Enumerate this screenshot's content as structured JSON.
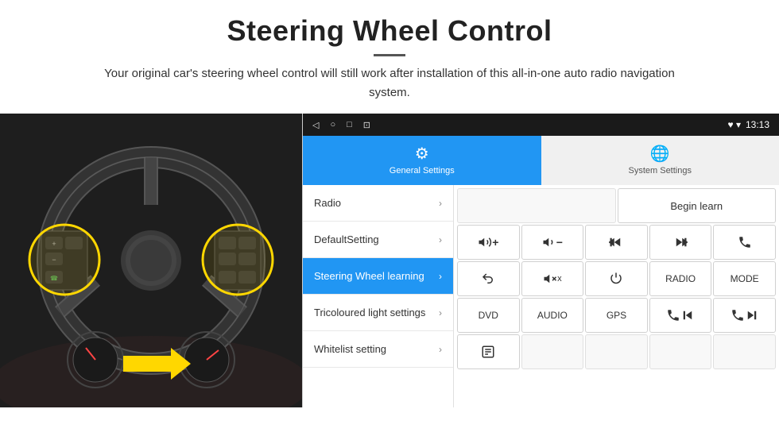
{
  "header": {
    "title": "Steering Wheel Control",
    "description": "Your original car's steering wheel control will still work after installation of this all-in-one auto radio navigation system."
  },
  "statusBar": {
    "navIcons": [
      "◁",
      "○",
      "□",
      "⊡"
    ],
    "rightIcons": "♥ ▾",
    "time": "13:13"
  },
  "tabs": [
    {
      "id": "general",
      "label": "General Settings",
      "active": true
    },
    {
      "id": "system",
      "label": "System Settings",
      "active": false
    }
  ],
  "menuItems": [
    {
      "id": "radio",
      "label": "Radio",
      "active": false
    },
    {
      "id": "default",
      "label": "DefaultSetting",
      "active": false
    },
    {
      "id": "steering",
      "label": "Steering Wheel learning",
      "active": true
    },
    {
      "id": "tricoloured",
      "label": "Tricoloured light settings",
      "active": false
    },
    {
      "id": "whitelist",
      "label": "Whitelist setting",
      "active": false
    }
  ],
  "controls": {
    "beginLearn": "Begin learn",
    "buttons": [
      [
        "vol+",
        "vol-",
        "prev",
        "next",
        "phone"
      ],
      [
        "back",
        "mute",
        "power",
        "RADIO",
        "MODE"
      ],
      [
        "DVD",
        "AUDIO",
        "GPS",
        "phone-prev",
        "skip-next"
      ],
      [
        "list",
        "",
        "",
        "",
        ""
      ]
    ]
  }
}
